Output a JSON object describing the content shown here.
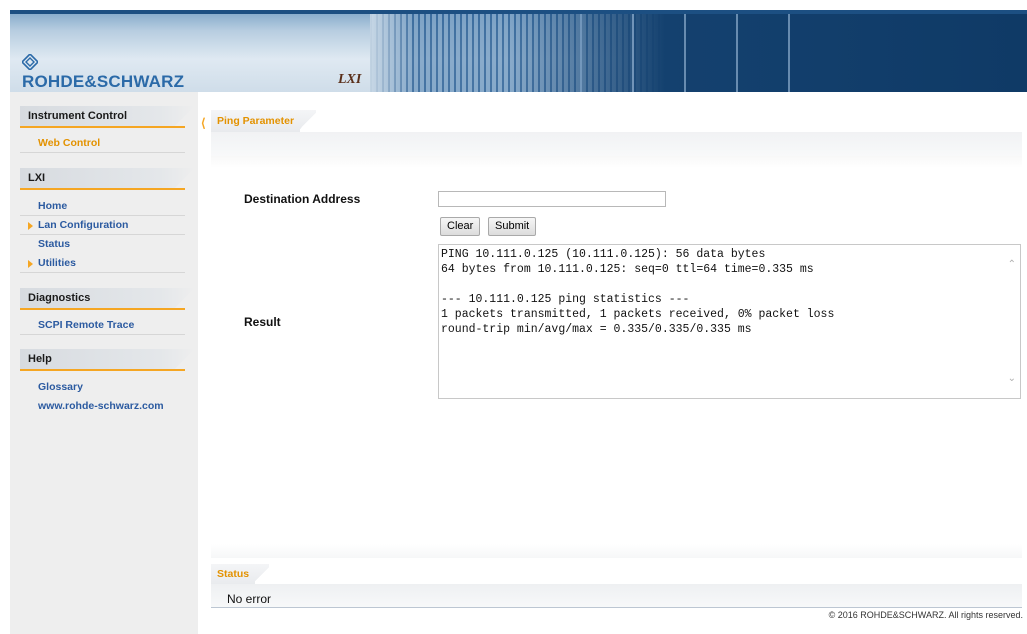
{
  "header": {
    "brand": "ROHDE&SCHWARZ",
    "lxi_logo": "LXI"
  },
  "sidebar": {
    "groups": [
      {
        "heading": "Instrument Control",
        "items": [
          {
            "label": "Web Control",
            "active": true,
            "arrow": false
          }
        ]
      },
      {
        "heading": "LXI",
        "items": [
          {
            "label": "Home",
            "active": false,
            "arrow": false
          },
          {
            "label": "Lan Configuration",
            "active": false,
            "arrow": true
          },
          {
            "label": "Status",
            "active": false,
            "arrow": false
          },
          {
            "label": "Utilities",
            "active": false,
            "arrow": true
          }
        ]
      },
      {
        "heading": "Diagnostics",
        "items": [
          {
            "label": "SCPI Remote Trace",
            "active": false,
            "arrow": false
          }
        ]
      },
      {
        "heading": "Help",
        "items": [
          {
            "label": "Glossary",
            "active": false,
            "arrow": false
          },
          {
            "label": "www.rohde-schwarz.com",
            "active": false,
            "arrow": false
          }
        ]
      }
    ]
  },
  "main": {
    "tab_label": "Ping Parameter",
    "destination_label": "Destination Address",
    "destination_value": "",
    "clear_label": "Clear",
    "submit_label": "Submit",
    "result_label": "Result",
    "result_text": "PING 10.111.0.125 (10.111.0.125): 56 data bytes\n64 bytes from 10.111.0.125: seq=0 ttl=64 time=0.335 ms\n\n--- 10.111.0.125 ping statistics ---\n1 packets transmitted, 1 packets received, 0% packet loss\nround-trip min/avg/max = 0.335/0.335/0.335 ms"
  },
  "status": {
    "tab_label": "Status",
    "message": "No error"
  },
  "footer": {
    "copyright": "© 2016 ROHDE&SCHWARZ. All rights reserved."
  },
  "colors": {
    "accent": "#f5a623",
    "link": "#2b5aa0",
    "header_dark": "#0f3a66"
  }
}
